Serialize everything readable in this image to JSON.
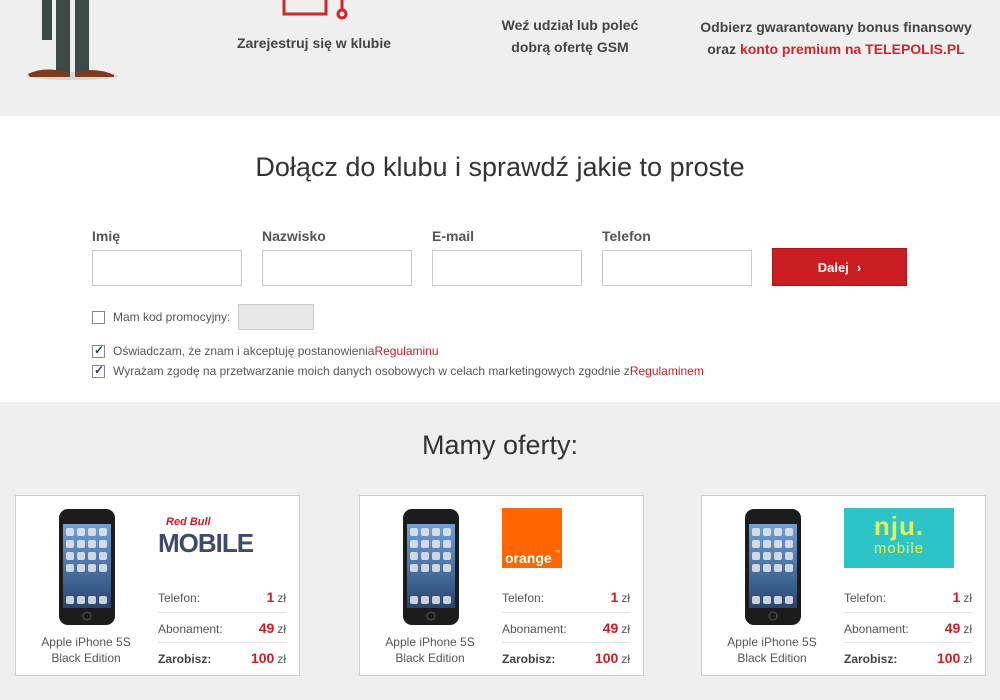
{
  "steps": {
    "step1": "Zarejestruj się w klubie",
    "step2_line1": "Weź udział lub poleć",
    "step2_line2": "dobrą ofertę GSM",
    "step3_line1": "Odbierz gwarantowany bonus finansowy",
    "step3_prefix": "oraz ",
    "step3_highlight": "konto premium na TELEPOLIS.PL"
  },
  "form": {
    "title": "Dołącz do klubu i sprawdź jakie to proste",
    "fields": [
      {
        "label": "Imię",
        "value": ""
      },
      {
        "label": "Nazwisko",
        "value": ""
      },
      {
        "label": "E-mail",
        "value": ""
      },
      {
        "label": "Telefon",
        "value": ""
      }
    ],
    "submit_label": "Dalej",
    "promo_label": "Mam kod promocyjny:",
    "promo_checked": false,
    "consent1_text": "Oświadczam, że znam i akceptuję postanowienia ",
    "consent1_link": "Regulaminu",
    "consent1_checked": true,
    "consent2_text": "Wyrażam zgodę na przetwarzanie moich danych osobowych w celach marketingowych zgodnie z ",
    "consent2_link": "Regulaminem",
    "consent2_checked": true
  },
  "offers": {
    "title": "Mamy oferty:",
    "cards": [
      {
        "brand": "red-bull-mobile",
        "brand_text_top": "Red Bull",
        "brand_text_main": "MOBILE",
        "phone_line1": "Apple iPhone 5S",
        "phone_line2": "Black Edition",
        "rows": [
          {
            "label": "Telefon:",
            "value": "1",
            "unit": "zł"
          },
          {
            "label": "Abonament:",
            "value": "49",
            "unit": "zł"
          },
          {
            "label": "Zarobisz:",
            "value": "100",
            "unit": "zł"
          }
        ]
      },
      {
        "brand": "orange",
        "brand_text_main": "orange",
        "brand_tm": "™",
        "phone_line1": "Apple iPhone 5S",
        "phone_line2": "Black Edition",
        "rows": [
          {
            "label": "Telefon:",
            "value": "1",
            "unit": "zł"
          },
          {
            "label": "Abonament:",
            "value": "49",
            "unit": "zł"
          },
          {
            "label": "Zarobisz:",
            "value": "100",
            "unit": "zł"
          }
        ]
      },
      {
        "brand": "nju-mobile",
        "brand_text_top": "nju.",
        "brand_text_main": "mobile",
        "phone_line1": "Apple iPhone 5S",
        "phone_line2": "Black Edition",
        "rows": [
          {
            "label": "Telefon:",
            "value": "1",
            "unit": "zł"
          },
          {
            "label": "Abonament:",
            "value": "49",
            "unit": "zł"
          },
          {
            "label": "Zarobisz:",
            "value": "100",
            "unit": "zł"
          }
        ]
      }
    ]
  },
  "colors": {
    "accent_red": "#c91d21",
    "band_gray": "#efefef",
    "orange_brand": "#ff6600",
    "nju_brand": "#2cc4c7"
  }
}
